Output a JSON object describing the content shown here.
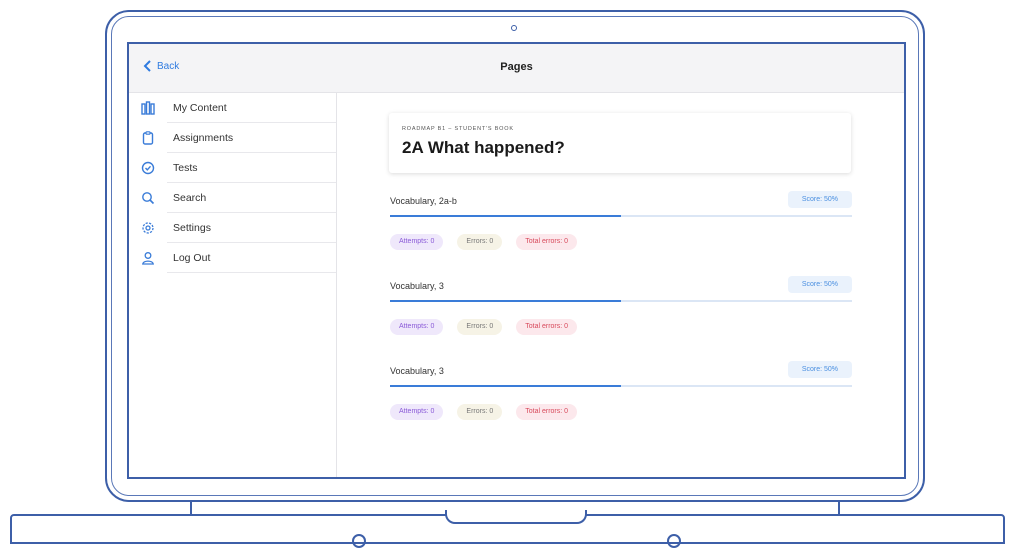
{
  "header": {
    "back_label": "Back",
    "title": "Pages"
  },
  "sidebar": {
    "items": [
      {
        "label": "My Content",
        "icon": "library-icon"
      },
      {
        "label": "Assignments",
        "icon": "clipboard-icon"
      },
      {
        "label": "Tests",
        "icon": "check-circle-icon"
      },
      {
        "label": "Search",
        "icon": "search-icon"
      },
      {
        "label": "Settings",
        "icon": "gear-icon"
      },
      {
        "label": "Log Out",
        "icon": "user-icon"
      }
    ]
  },
  "book": {
    "subtitle": "ROADMAP B1 – STUDENT'S BOOK",
    "title": "2A What happened?"
  },
  "sections": [
    {
      "title": "Vocabulary, 2a-b",
      "score": "Score: 50%",
      "progress": 0.5,
      "attempts": "Attempts: 0",
      "errors": "Errors: 0",
      "total_errors": "Total errors: 0"
    },
    {
      "title": "Vocabulary, 3",
      "score": "Score: 50%",
      "progress": 0.5,
      "attempts": "Attempts: 0",
      "errors": "Errors: 0",
      "total_errors": "Total errors: 0"
    },
    {
      "title": "Vocabulary, 3",
      "score": "Score: 50%",
      "progress": 0.5,
      "attempts": "Attempts: 0",
      "errors": "Errors: 0",
      "total_errors": "Total errors: 0"
    }
  ],
  "colors": {
    "accent": "#2f7be0",
    "frame": "#3d5fa8"
  }
}
